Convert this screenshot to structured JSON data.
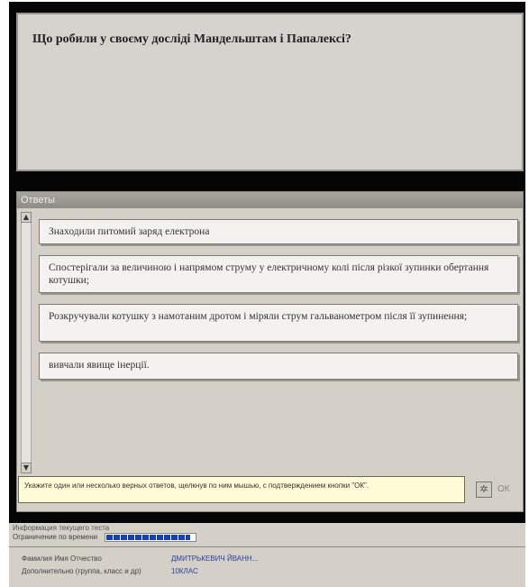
{
  "question": {
    "text": "Що робили у своєму досліді Мандельштам і Папалексі?"
  },
  "answers_panel": {
    "header": "Ответы",
    "items": [
      {
        "label": "Знаходили питомий заряд електрона"
      },
      {
        "label": "Спостерігали за величиною і напрямом струму у електричному колі після різкої зупинки обертання котушки;"
      },
      {
        "label": "Розкручували котушку з намотаним дротом і міряли струм гальванометром після її зупинення;"
      },
      {
        "label": "вивчали явище інерції."
      }
    ],
    "scroll_up": "▲",
    "scroll_down": "▼"
  },
  "hint": {
    "text": "Укажите один или несколько верных ответов, щелкнув по ним мышью, с подтверждением кнопки \"ОК\"."
  },
  "ok_button": {
    "icon": "✲",
    "label": "ОК"
  },
  "status": {
    "title": "Информация текущего теста",
    "limit_label": "Ограничение по времени",
    "progress": 0.95,
    "name_label": "Фамилия Имя Отчество",
    "name_value": "ДМИТРЬКЕВИЧ ЙВАНН...",
    "extra_label": "Дополнительно (группа, класс и др)",
    "extra_value": "10КЛАС"
  }
}
